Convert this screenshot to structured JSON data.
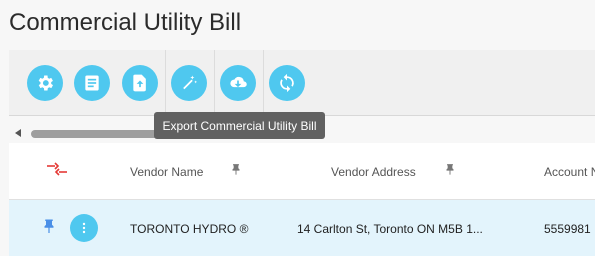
{
  "page": {
    "title": "Commercial Utility Bill"
  },
  "toolbar": {
    "buttons": [
      {
        "name": "settings",
        "icon": "gear-icon"
      },
      {
        "name": "details",
        "icon": "document-icon"
      },
      {
        "name": "upload",
        "icon": "file-upload-icon"
      },
      {
        "name": "magic",
        "icon": "magic-wand-icon"
      },
      {
        "name": "export",
        "icon": "cloud-download-icon"
      },
      {
        "name": "refresh",
        "icon": "sync-icon"
      }
    ],
    "tooltip": "Export Commercial Utility Bill"
  },
  "grid": {
    "columns": {
      "vendor_name": "Vendor Name",
      "vendor_address": "Vendor Address",
      "account_number": "Account N"
    },
    "rows": [
      {
        "vendor_name": "TORONTO HYDRO ®",
        "vendor_address": "14 Carlton St, Toronto ON M5B 1...",
        "account_number": "5559981"
      }
    ]
  },
  "colors": {
    "accent": "#4fc8ef",
    "row_selected": "#e3f4fc",
    "tooltip_bg": "#616161",
    "arrows": "#e53935",
    "pin": "#4a8fe7"
  }
}
